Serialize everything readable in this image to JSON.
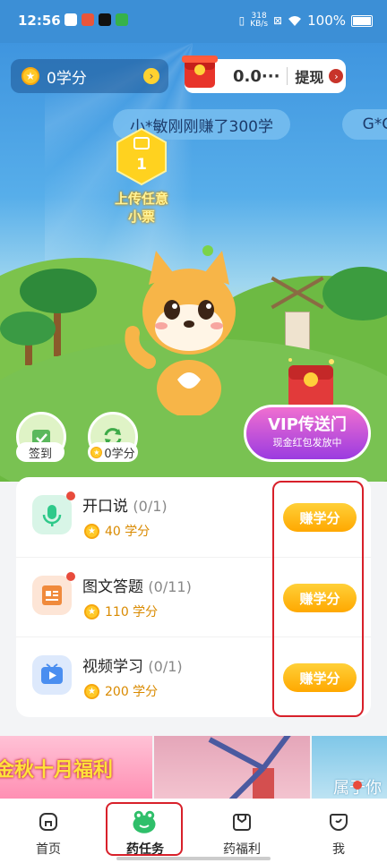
{
  "status_bar": {
    "time": "12:56",
    "net_speed_top": "318",
    "net_speed_bottom": "KB/s",
    "battery": "100%"
  },
  "header": {
    "points_value": "0学分",
    "cash_value": "0.0···",
    "withdraw_label": "提现"
  },
  "ticker": {
    "items": [
      "小*敏刚刚赚了300学",
      "G*G"
    ]
  },
  "upload_badge": {
    "count": "1",
    "label_line1": "上传任意",
    "label_line2": "小票"
  },
  "quick_actions": {
    "sign_in_label": "签到",
    "refresh_points_label": "0学分"
  },
  "vip_banner": {
    "title": "VIP传送门",
    "subtitle": "现金红包发放中"
  },
  "tasks": [
    {
      "title": "开口说",
      "progress": "(0/1)",
      "reward": "40 学分",
      "button": "赚学分",
      "icon": "microphone-icon",
      "color": "#2fc98a",
      "bg": "#dff7ec"
    },
    {
      "title": "图文答题",
      "progress": "(0/11)",
      "reward": "110 学分",
      "button": "赚学分",
      "icon": "quiz-card-icon",
      "color": "#f08a3c",
      "bg": "#fde9dc"
    },
    {
      "title": "视频学习",
      "progress": "(0/1)",
      "reward": "200 学分",
      "button": "赚学分",
      "icon": "video-icon",
      "color": "#4a8ef0",
      "bg": "#e1ecfd"
    }
  ],
  "promo": {
    "left_text": "金秋十月福利",
    "right_text": "属于你"
  },
  "bottom_nav": [
    {
      "label": "首页",
      "icon": "home-icon"
    },
    {
      "label": "药任务",
      "icon": "task-frog-icon",
      "active": true
    },
    {
      "label": "药福利",
      "icon": "welfare-icon"
    },
    {
      "label": "我",
      "icon": "profile-icon"
    }
  ],
  "colors": {
    "accent_orange": "#ffb000",
    "highlight_red": "#d8202a",
    "nav_active_green": "#2fbf6a"
  }
}
